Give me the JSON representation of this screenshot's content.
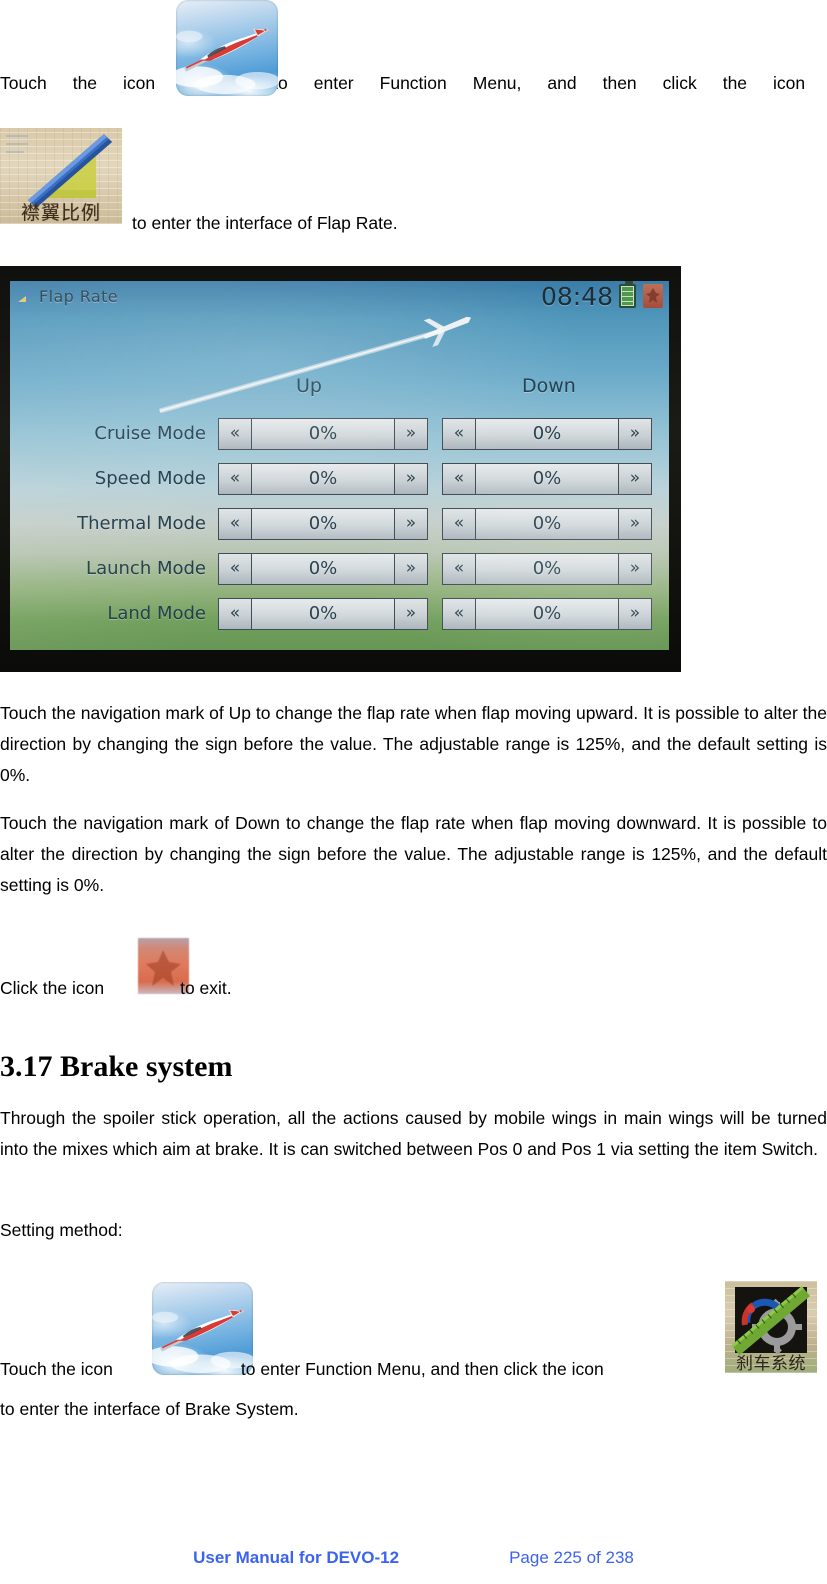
{
  "intro": {
    "t1": "Touch",
    "t2": "the",
    "t3": "icon",
    "t4": "to",
    "t5": "enter",
    "t6": "Function",
    "t7": "Menu,",
    "t8": "and",
    "t9": "then",
    "t10": "click",
    "t11": "the",
    "t12": "icon",
    "line2": "to enter the interface of Flap Rate.",
    "glider_icon_name": "glider-app-icon",
    "flap_icon_name": "flap-rate-menu-icon",
    "flap_icon_cn": "襟翼比例"
  },
  "device": {
    "screen_title": "Flap Rate",
    "clock": "08:48",
    "battery_icon": "battery-full-icon",
    "exit_icon": "exit-icon",
    "columns": [
      "Up",
      "Down"
    ],
    "rows": [
      {
        "label": "Cruise Mode",
        "up": "0%",
        "down": "0%"
      },
      {
        "label": "Speed Mode",
        "up": "0%",
        "down": "0%"
      },
      {
        "label": "Thermal Mode",
        "up": "0%",
        "down": "0%"
      },
      {
        "label": "Launch Mode",
        "up": "0%",
        "down": "0%"
      },
      {
        "label": "Land Mode",
        "up": "0%",
        "down": "0%"
      }
    ],
    "nav_left": "«",
    "nav_right": "»"
  },
  "body": {
    "para_up": "Touch the navigation mark of Up to change the flap rate when flap moving upward. It is possible to alter the direction by changing the sign before the value. The adjustable range is 125%, and the default setting is 0%.",
    "para_down": "Touch the navigation mark of Down to change the flap rate when flap moving downward. It is possible to alter the direction by changing the sign before the value. The adjustable range is 125%, and the default setting is 0%.",
    "exit_pre": "Click the icon",
    "exit_post": "to exit."
  },
  "section": {
    "heading": "3.17 Brake system",
    "para1": "Through the spoiler stick operation, all the actions caused by mobile wings in main wings will be turned into the mixes which aim at brake. It is can switched between Pos 0 and Pos 1 via setting the item Switch.",
    "setting_method": "Setting method:",
    "last_pre": "Touch the icon",
    "last_mid": "to enter Function Menu, and then click the icon",
    "last_tail": "to enter the interface of Brake System.",
    "brake_icon_cn": "刹车系统"
  },
  "footer": {
    "manual": "User Manual for DEVO-12",
    "page": "Page 225 of 238",
    "link_color": "#3b63f0"
  }
}
